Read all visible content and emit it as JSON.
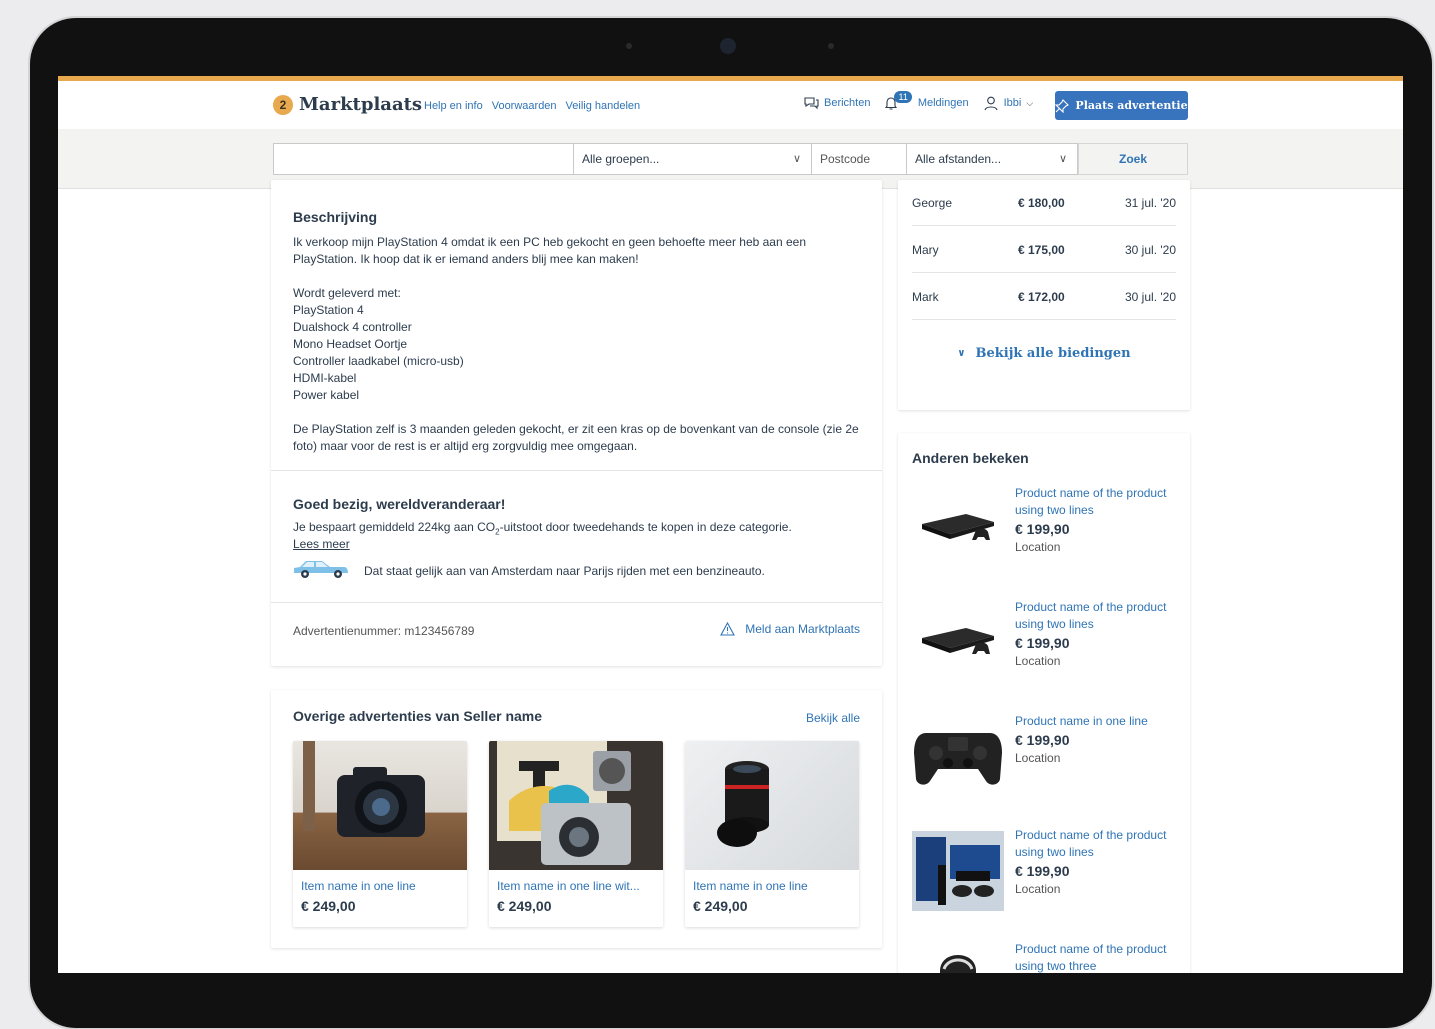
{
  "header": {
    "brand": "Marktplaats",
    "links": [
      "Help en info",
      "Voorwaarden",
      "Veilig handelen"
    ],
    "messages_label": "Berichten",
    "notifications_label": "Meldingen",
    "notifications_count": "11",
    "user_label": "Ibbi",
    "place_ad_label": "Plaats advertentie"
  },
  "search": {
    "query": "",
    "group_select": "Alle groepen...",
    "postcode_placeholder": "Postcode",
    "distance_select": "Alle afstanden...",
    "submit_label": "Zoek"
  },
  "description": {
    "title": "Beschrijving",
    "paragraph1": "Ik verkoop mijn PlayStation 4 omdat ik een PC heb gekocht en geen behoefte meer heb aan een PlayStation. Ik hoop dat ik er iemand anders blij mee kan maken!",
    "delivered_with_label": "Wordt geleverd met:",
    "items": [
      "PlayStation 4",
      "Dualshock 4 controller",
      "Mono Headset Oortje",
      "Controller laadkabel (micro-usb)",
      "HDMI-kabel",
      "Power kabel"
    ],
    "paragraph2": "De PlayStation zelf is 3 maanden geleden gekocht, er zit een kras op de bovenkant van de console (zie 2e foto) maar voor de rest is er altijd erg zorgvuldig mee omgegaan."
  },
  "co2": {
    "title": "Goed bezig, wereldveranderaar!",
    "text_before": "Je bespaart gemiddeld 224kg aan CO",
    "text_sub": "2",
    "text_after": "-uitstoot door tweedehands te kopen in deze categorie.",
    "read_more": "Lees meer",
    "car_text": "Dat staat gelijk aan van Amsterdam naar Parijs rijden met een benzineauto."
  },
  "ad_meta": {
    "ad_number": "Advertentienummer: m123456789",
    "report_label": "Meld aan Marktplaats"
  },
  "bids": {
    "rows": [
      {
        "name": "George",
        "price": "€ 180,00",
        "date": "31 jul. '20"
      },
      {
        "name": "Mary",
        "price": "€ 175,00",
        "date": "30 jul. '20"
      },
      {
        "name": "Mark",
        "price": "€ 172,00",
        "date": "30 jul. '20"
      }
    ],
    "show_all_label": "Bekijk alle biedingen"
  },
  "others": {
    "title": "Anderen bekeken",
    "items": [
      {
        "name": "Product name of the product using two lines",
        "price": "€ 199,90",
        "location": "Location",
        "icon": "ps4-console"
      },
      {
        "name": "Product name of the product using two lines",
        "price": "€ 199,90",
        "location": "Location",
        "icon": "ps4-console"
      },
      {
        "name": "Product name in one line",
        "price": "€ 199,90",
        "location": "Location",
        "icon": "ps4-controller"
      },
      {
        "name": "Product name of the product using two lines",
        "price": "€ 199,90",
        "location": "Location",
        "icon": "ps4-bundle"
      },
      {
        "name": "Product name of the product using two three",
        "price": "",
        "location": "",
        "icon": "vr-headset"
      }
    ]
  },
  "seller_ads": {
    "title": "Overige advertenties van Seller name",
    "see_all_label": "Bekijk alle",
    "items": [
      {
        "name": "Item name in one line",
        "price": "€ 249,00",
        "icon": "camera"
      },
      {
        "name": "Item name in one line wit...",
        "price": "€ 249,00",
        "icon": "instant-camera"
      },
      {
        "name": "Item name in one line",
        "price": "€ 249,00",
        "icon": "lens"
      }
    ]
  },
  "colors": {
    "accent": "#e8a94e",
    "link": "#2f74b5",
    "primary_button": "#3873bd",
    "text": "#2d3c4d"
  }
}
